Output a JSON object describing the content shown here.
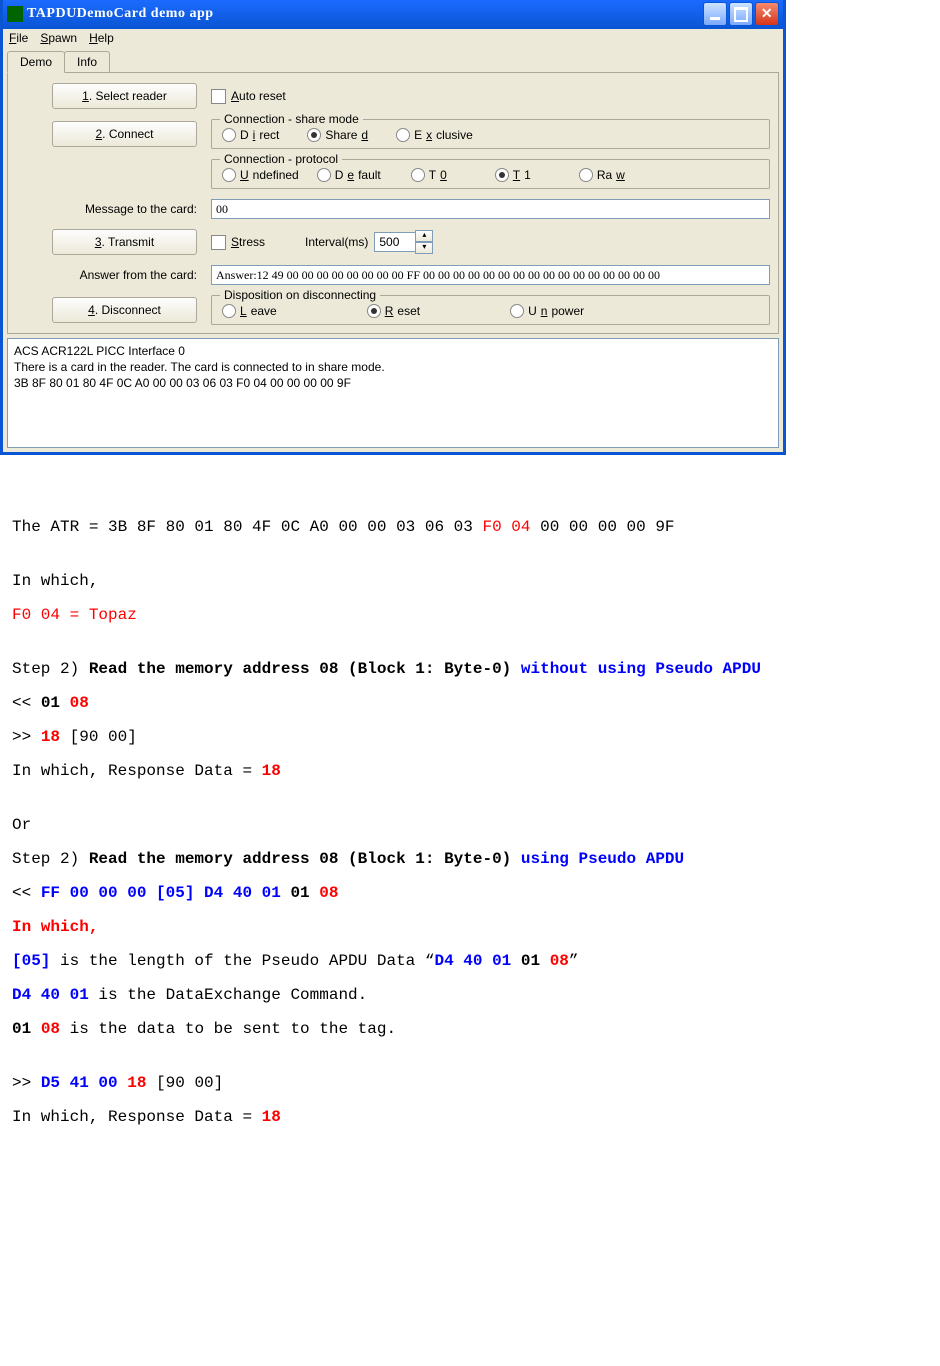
{
  "window": {
    "title": "TAPDUDemoCard demo app"
  },
  "menu": {
    "file": "File",
    "spawn": "Spawn",
    "help": "Help"
  },
  "tabs": {
    "demo": "Demo",
    "info": "Info"
  },
  "buttons": {
    "select_reader": "1. Select reader",
    "connect": "2. Connect",
    "transmit": "3. Transmit",
    "disconnect": "4. Disconnect"
  },
  "labels": {
    "auto_reset": "Auto reset",
    "share_mode": "Connection - share mode",
    "protocol": "Connection - protocol",
    "msg_to_card": "Message to the card:",
    "stress": "Stress",
    "interval": "Interval(ms)",
    "answer_from": "Answer from the card:",
    "disposition": "Disposition on disconnecting"
  },
  "share_opts": {
    "direct": "Direct",
    "shared": "Shared",
    "exclusive": "Exclusive"
  },
  "protocol_opts": {
    "undefined": "Undefined",
    "default": "Default",
    "t0": "T0",
    "t1": "T1",
    "raw": "Raw"
  },
  "disposition_opts": {
    "leave": "Leave",
    "reset": "Reset",
    "unpower": "Unpower"
  },
  "inputs": {
    "message": "00",
    "interval": "500",
    "answer": "Answer:12 49 00 00 00 00 00 00 00 00 FF 00 00 00 00 00 00 00 00 00 00 00 00 00 00 00 00"
  },
  "status": "ACS ACR122L PICC Interface 0\nThere is a card in the reader. The card is connected to in share mode.\n3B 8F 80 01 80 4F 0C A0 00 00 03 06 03 F0 04 00 00 00 00 9F",
  "doc": {
    "atr_prefix": "The ATR = 3B 8F 80 01 80 4F 0C A0 00 00 03 06 03 ",
    "atr_red": "F0 04",
    "atr_suffix": " 00 00 00 00 9F",
    "in_which": "In which,",
    "topaz": "F0 04 = Topaz",
    "step2a_pre": "Step 2) ",
    "step2a_bold": "Read the memory address 08 (Block 1: Byte-0) ",
    "step2a_blue": "without using Pseudo APDU",
    "cmd1_l": "<< ",
    "cmd1_a": "01 ",
    "cmd1_b": "08",
    "resp1_l": ">> ",
    "resp1_a": "18",
    "resp1_suffix": " [90 00]",
    "resp_data": "In which, Response Data = ",
    "resp_val": "18",
    "or": "Or",
    "step2b_blue": "using Pseudo APDU",
    "cmd2_l": "<< ",
    "cmd2_blue": "FF 00 00 00 [05] D4 40 01 ",
    "cmd2_bold": "01 ",
    "cmd2_red": "08",
    "in_which_red": "In which,",
    "expl_len_a": "[05]",
    "expl_len_b": " is the length of the Pseudo APDU Data “",
    "expl_len_c": "D4 40 01 ",
    "expl_len_d": "01 ",
    "expl_len_e": "08",
    "expl_len_f": "”",
    "expl_de_a": "D4 40 01",
    "expl_de_b": " is the DataExchange Command.",
    "expl_data_a": "01 ",
    "expl_data_b": "08",
    "expl_data_c": " is the data to be sent to the tag.",
    "resp2_l": ">> ",
    "resp2_blue": "D5 41 00 ",
    "resp2_red": "18",
    "resp2_suffix": " [90 00]"
  }
}
